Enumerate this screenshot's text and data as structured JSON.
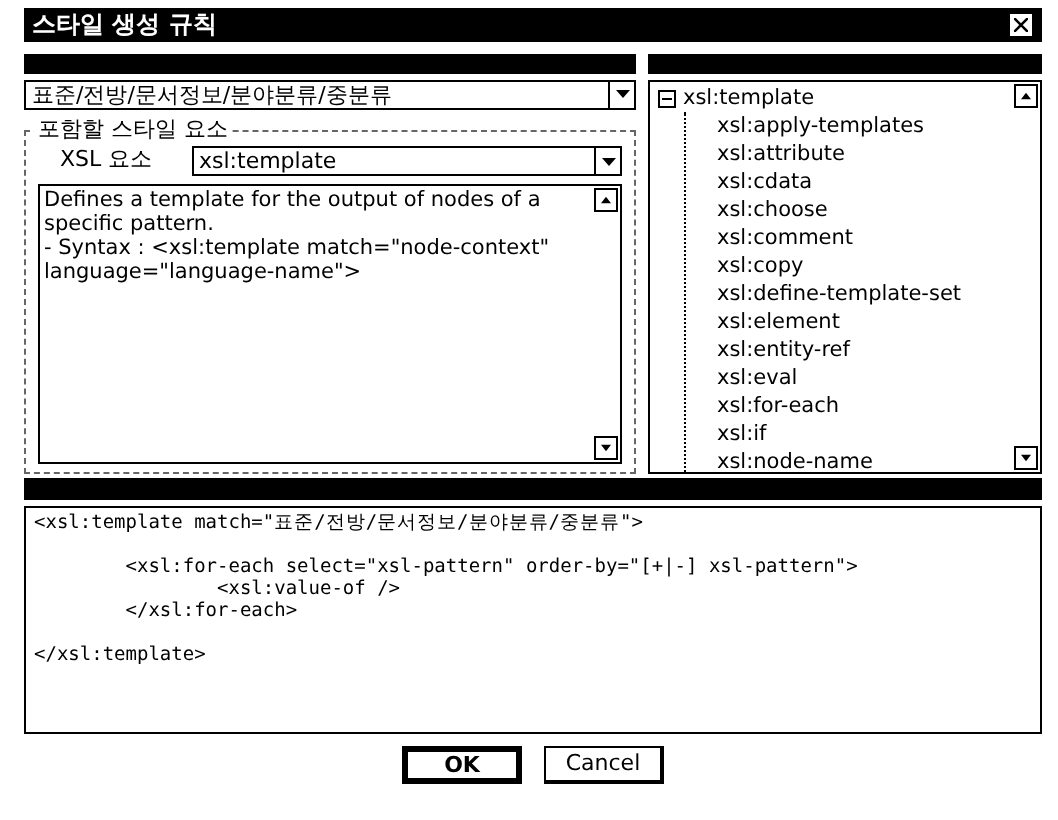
{
  "window": {
    "title": "스타일 생성 규칙"
  },
  "path_select": {
    "value": "표준/전방/문서정보/분야분류/중분류"
  },
  "style_group": {
    "label": "포함할 스타일 요소",
    "xsl_label": "XSL 요소",
    "xsl_value": "xsl:template",
    "description": "Defines a template for the output of nodes of a specific pattern.\n- Syntax : <xsl:template match=\"node-context\" language=\"language-name\">"
  },
  "tree": [
    {
      "label": "xsl:template",
      "expanded": true,
      "children": [
        {
          "label": "xsl:apply-templates"
        },
        {
          "label": "xsl:attribute"
        },
        {
          "label": "xsl:cdata"
        },
        {
          "label": "xsl:choose"
        },
        {
          "label": "xsl:comment"
        },
        {
          "label": "xsl:copy"
        },
        {
          "label": "xsl:define-template-set"
        },
        {
          "label": "xsl:element"
        },
        {
          "label": "xsl:entity-ref"
        },
        {
          "label": "xsl:eval"
        },
        {
          "label": "xsl:for-each"
        },
        {
          "label": "xsl:if"
        },
        {
          "label": "xsl:node-name"
        }
      ]
    }
  ],
  "code": "<xsl:template match=\"표준/전방/문서정보/분야분류/중분류\">\n\n        <xsl:for-each select=\"xsl-pattern\" order-by=\"[+|-] xsl-pattern\">\n                <xsl:value-of />\n        </xsl:for-each>\n\n</xsl:template>",
  "buttons": [
    {
      "label": "OK",
      "selected": true
    },
    {
      "label": "Cancel",
      "selected": false
    }
  ]
}
